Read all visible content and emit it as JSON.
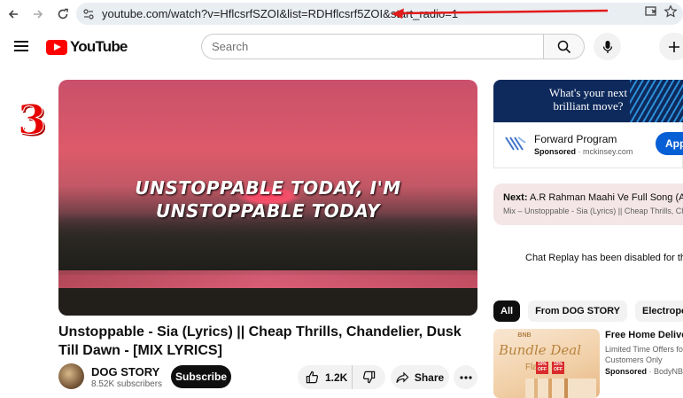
{
  "browser": {
    "url": "youtube.com/watch?v=HflcsrfSZOI&list=RDHflcsrf5ZOI&start_radio=1"
  },
  "header": {
    "logo_text": "YouTube",
    "search_placeholder": "Search"
  },
  "annotation": {
    "number": "3",
    "color": "#e60000"
  },
  "player": {
    "lyric_line1": "UNSTOPPABLE TODAY, I'M",
    "lyric_line2": "UNSTOPPABLE TODAY"
  },
  "video": {
    "title": "Unstoppable - Sia (Lyrics) || Cheap Thrills, Chandelier, Dusk Till Dawn - [MIX LYRICS]",
    "channel_name": "DOG STORY",
    "subscribers": "8.52K subscribers",
    "subscribe_label": "Subscribe",
    "likes": "1.2K",
    "share_label": "Share"
  },
  "ad": {
    "headline_line1": "What's your next",
    "headline_line2": "brilliant move?",
    "title": "Forward Program",
    "sponsored_label": "Sponsored",
    "domain": "mckinsey.com",
    "cta_label": "Apply"
  },
  "next_up": {
    "prefix": "Next:",
    "title": "A.R Rahman Maahi Ve Full Song (Audio",
    "playlist": "Mix – Unstoppable - Sia (Lyrics) || Cheap Thrills, Chan"
  },
  "chat": {
    "message": "Chat Replay has been disabled for this P"
  },
  "chips": [
    {
      "label": "All",
      "active": true
    },
    {
      "label": "From DOG STORY",
      "active": false
    },
    {
      "label": "Electropop",
      "active": false
    }
  ],
  "recommendation": {
    "thumb_brand": "BNB",
    "thumb_title": "Bundle Deal",
    "thumb_flat": "Flat",
    "thumb_off1": "10% OFF",
    "thumb_off2": "15% OFF",
    "title": "Free Home Delivery",
    "description": "Limited Time Offers for Customers Only",
    "sponsored_label": "Sponsored",
    "advertiser": "BodyNBo"
  },
  "colors": {
    "brand_red": "#ff0000",
    "apply_blue": "#065fd4",
    "annotation_red": "#e60000"
  }
}
